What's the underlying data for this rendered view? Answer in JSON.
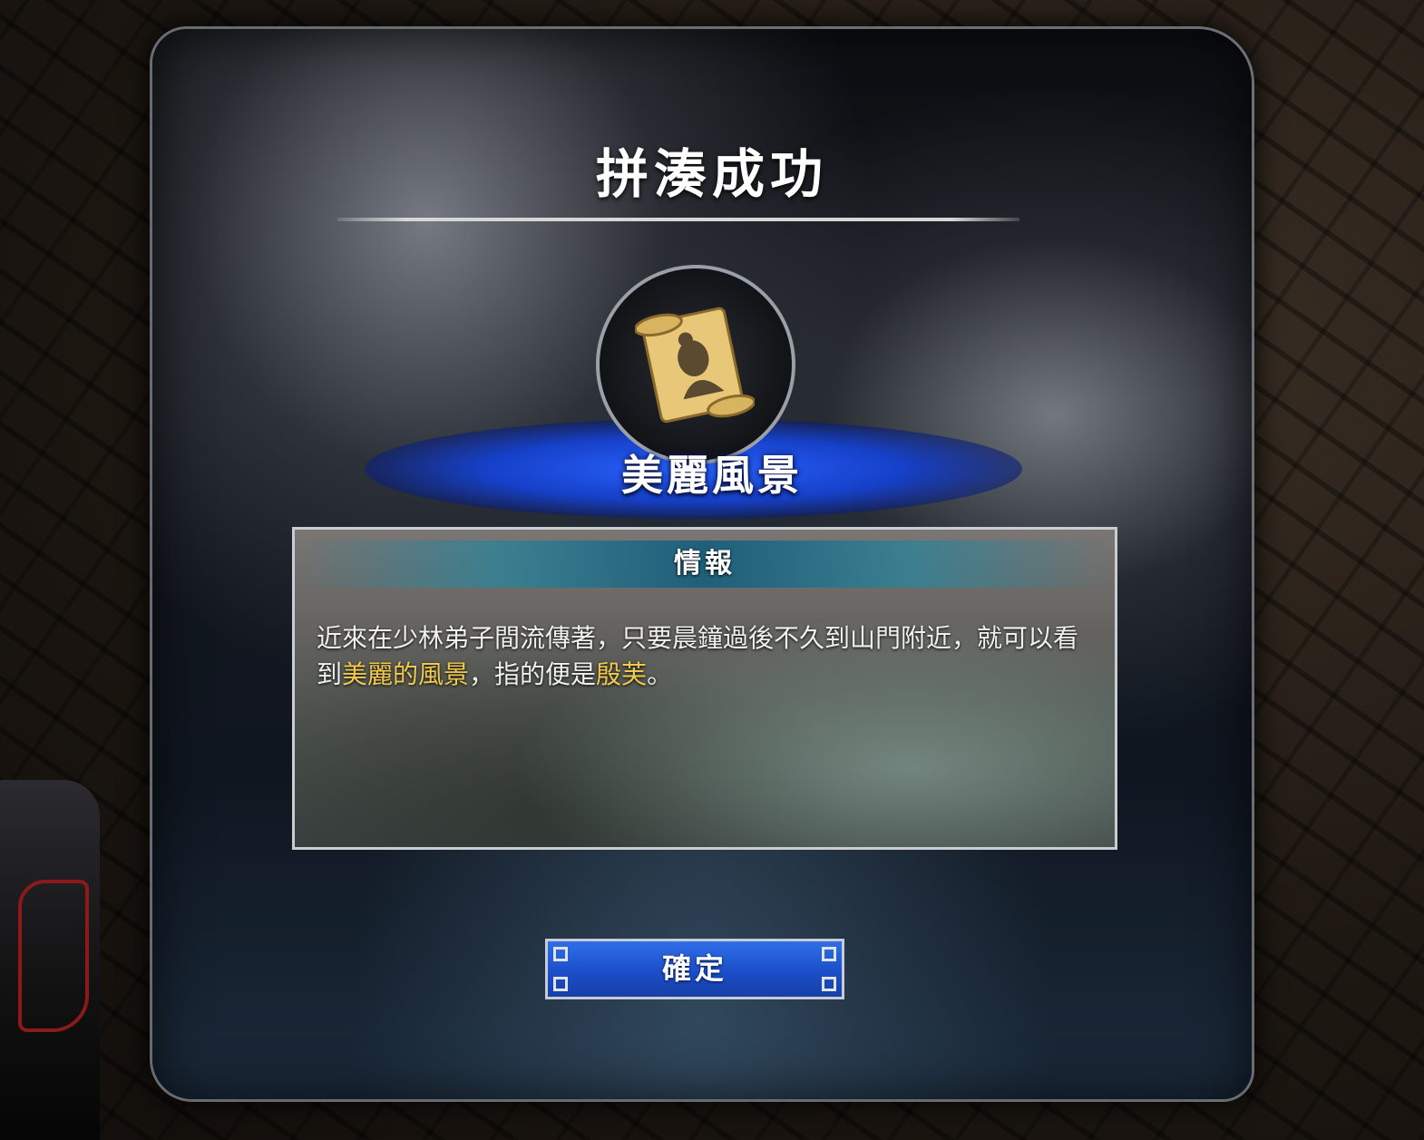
{
  "dialog": {
    "title": "拼湊成功",
    "item": {
      "name": "美麗風景",
      "icon": "portrait-scroll-icon"
    },
    "info": {
      "header": "情報",
      "text_parts": {
        "p1": "近來在少林弟子間流傳著，只要晨鐘過後不久到山門附近，就可以看到",
        "highlight1": "美麗的風景",
        "p2": "，指的便是",
        "highlight2": "殷芙",
        "p3": "。"
      }
    },
    "confirm_label": "確定"
  },
  "colors": {
    "highlight": "#f2c94c",
    "button": "#1c4ec9",
    "glow": "#2a63ff"
  }
}
